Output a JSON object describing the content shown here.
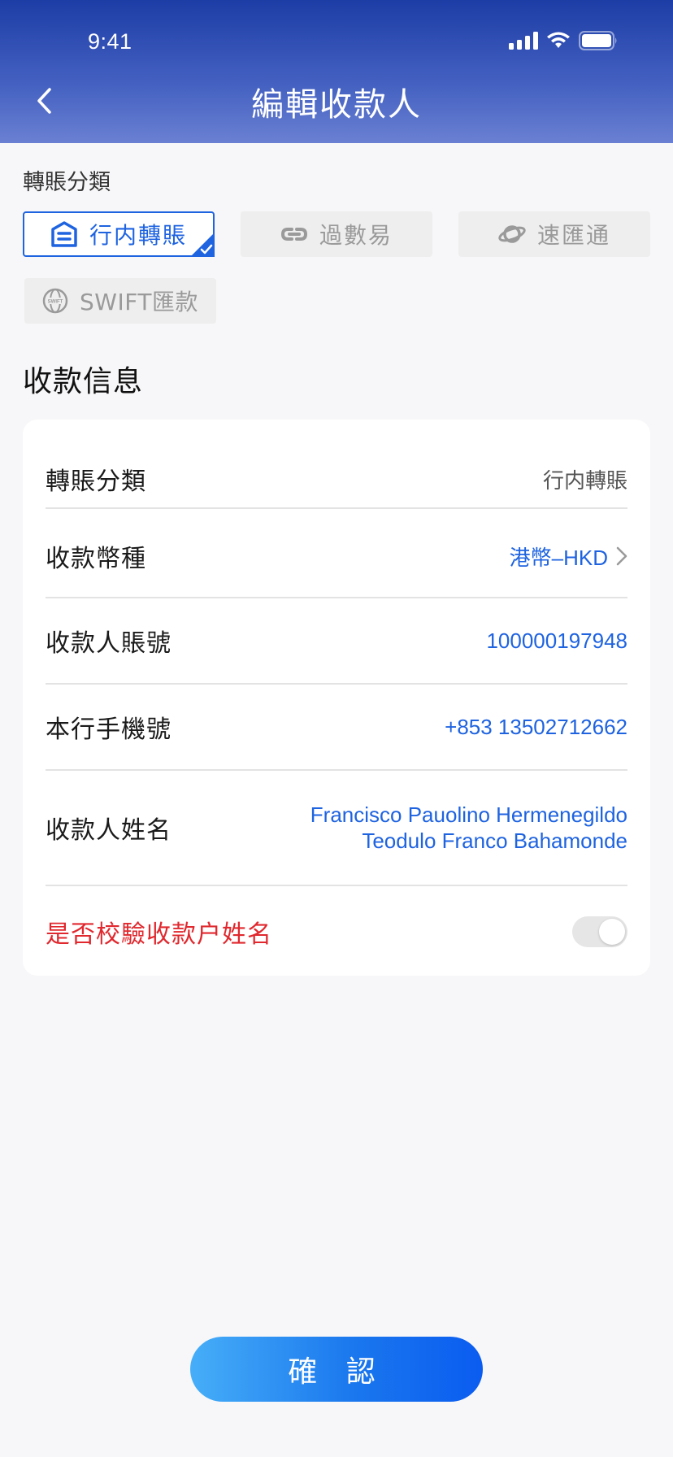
{
  "status_bar": {
    "time": "9:41"
  },
  "header": {
    "title": "編輯收款人"
  },
  "transfer_category": {
    "label": "轉賬分類",
    "options": [
      {
        "label": "行内轉賬",
        "icon": "bank-icon",
        "selected": true
      },
      {
        "label": "過數易",
        "icon": "link-icon",
        "selected": false
      },
      {
        "label": "速匯通",
        "icon": "planet-icon",
        "selected": false
      },
      {
        "label": "SWIFT匯款",
        "icon": "globe-swift-icon",
        "selected": false
      }
    ]
  },
  "payee_info": {
    "title": "收款信息",
    "rows": [
      {
        "key": "轉賬分類",
        "value": "行内轉賬"
      },
      {
        "key": "收款幣種",
        "value": "港幣–HKD"
      },
      {
        "key": "收款人賬號",
        "value": "100000197948"
      },
      {
        "key": "本行手機號",
        "value": "+853 13502712662"
      },
      {
        "key": "收款人姓名",
        "value_line1": "Francisco Pauolino Hermenegildo",
        "value_line2": "Teodulo Franco Bahamonde"
      },
      {
        "key": "是否校驗收款户姓名",
        "toggle_on": false
      }
    ]
  },
  "confirm": {
    "label": "確 認"
  },
  "colors": {
    "accent": "#1e63e0",
    "warning": "#e0282e",
    "header": "#2d4bb4"
  }
}
